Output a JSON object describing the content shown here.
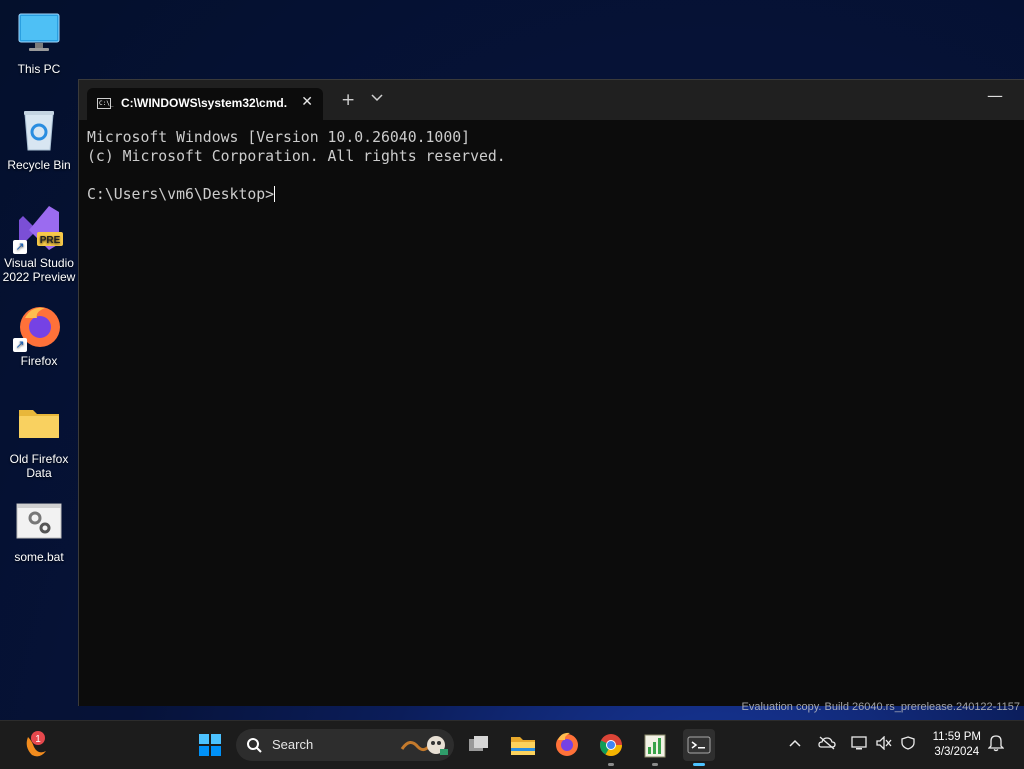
{
  "desktop": {
    "icons": [
      {
        "label_1": "This PC",
        "label_2": ""
      },
      {
        "label_1": "Recycle Bin",
        "label_2": ""
      },
      {
        "label_1": "Visual Studio",
        "label_2": "2022 Preview",
        "badge": "PRE"
      },
      {
        "label_1": "Firefox",
        "label_2": ""
      },
      {
        "label_1": "Old Firefox",
        "label_2": "Data"
      },
      {
        "label_1": "some.bat",
        "label_2": ""
      }
    ]
  },
  "terminal": {
    "tab_title": "C:\\WINDOWS\\system32\\cmd.",
    "tab_icon_text": "C:\\_",
    "new_tab_symbol": "+",
    "dropdown_symbol": "⌄",
    "close_symbol": "✕",
    "minimize_symbol": "—",
    "lines": [
      "Microsoft Windows [Version 10.0.26040.1000]",
      "(c) Microsoft Corporation. All rights reserved.",
      "",
      "C:\\Users\\vm6\\Desktop>"
    ]
  },
  "watermark": "Evaluation copy. Build 26040.rs_prerelease.240122-1157",
  "taskbar": {
    "notification_count": "1",
    "search_label": "Search",
    "time": "11:59 PM",
    "date": "3/3/2024",
    "colors": {
      "background": "#1c1c1c",
      "accent": "#0078d4"
    }
  }
}
